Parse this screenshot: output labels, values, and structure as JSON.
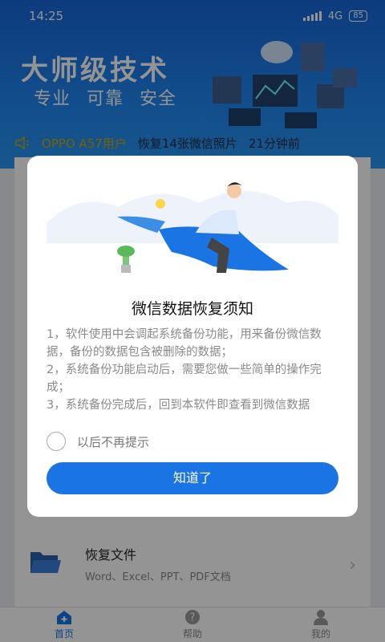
{
  "status_bar": {
    "time": "14:25",
    "network": "4G",
    "battery": "85"
  },
  "hero": {
    "title": "大师级技术",
    "subtitle": "专业 可靠 安全"
  },
  "ticker": {
    "user": "OPPO A57用户",
    "action": "恢复14张微信照片",
    "time_ago": "21分钟前"
  },
  "feature": {
    "title": "恢复文件",
    "desc": "Word、Excel、PPT、PDF文档"
  },
  "tabbar": {
    "items": [
      {
        "label": "首页",
        "icon": "home-icon",
        "active": true
      },
      {
        "label": "帮助",
        "icon": "help-icon",
        "active": false
      },
      {
        "label": "我的",
        "icon": "user-icon",
        "active": false
      }
    ]
  },
  "dialog": {
    "title": "微信数据恢复须知",
    "lines": [
      "1，软件使用中会调起系统备份功能，用来备份微信数据，备份的数据包含被删除的数据；",
      "2，系统备份功能启动后，需要您做一些简单的操作完成；",
      "3，系统备份完成后，回到本软件即查看到微信数据"
    ],
    "checkbox_label": "以后不再提示",
    "button_label": "知道了"
  },
  "colors": {
    "accent": "#1b74e4",
    "hero_top": "#1766d9",
    "ticker_user": "#c9a800"
  }
}
